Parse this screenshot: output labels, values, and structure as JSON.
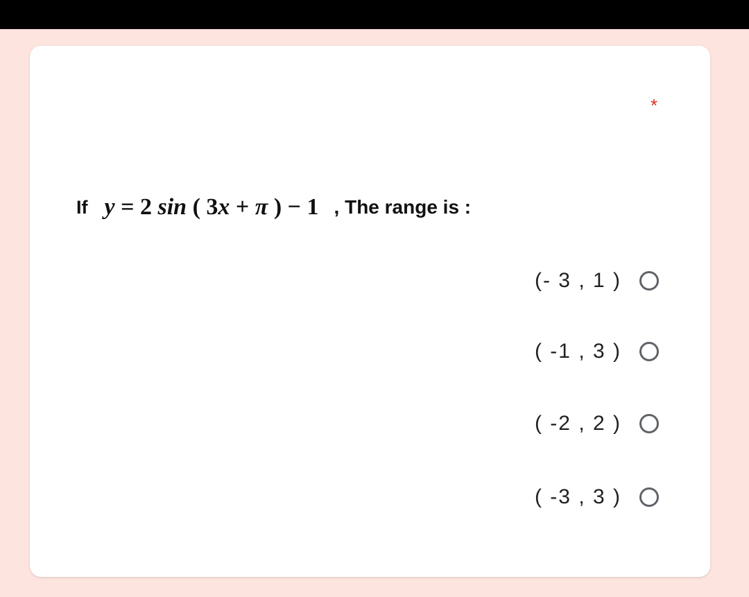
{
  "form": {
    "required_marker": "*",
    "question": {
      "prefix": "If",
      "formula": {
        "y": "y",
        "eq": " = 2 ",
        "sin": "sin",
        "open": " ( 3",
        "x": "x",
        "plus": " + ",
        "pi": "π",
        "close": " ) − 1"
      },
      "suffix": ", The range is :"
    },
    "options": [
      {
        "label": "(- 3 , 1 )",
        "selected": false
      },
      {
        "label": "( -1 , 3 )",
        "selected": false
      },
      {
        "label": "( -2 , 2 )",
        "selected": false
      },
      {
        "label": "( -3 , 3 )",
        "selected": false
      }
    ],
    "colors": {
      "background": "#fde4df",
      "required": "#d93025",
      "radio_border": "#5f6368"
    }
  }
}
